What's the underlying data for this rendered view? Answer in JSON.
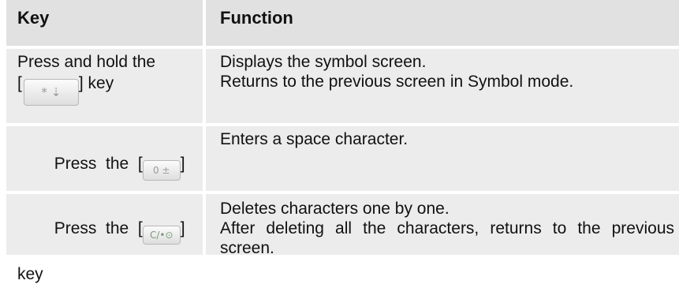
{
  "header": {
    "key": "Key",
    "function": "Function"
  },
  "rows": [
    {
      "key_before": "Press and hold the",
      "key_bracket_open": "[",
      "key_icon": "star-key-icon",
      "key_icon_text": "* ⇣",
      "key_after": "] key",
      "function_lines": [
        "Displays the symbol screen.",
        "Returns to the previous screen in Symbol mode."
      ]
    },
    {
      "key_before": "Press  the  [",
      "key_icon": "zero-key-icon",
      "key_icon_text": "0 ±",
      "key_after": "]",
      "key_last": "key",
      "function_lines": [
        "Enters a space character."
      ]
    },
    {
      "key_before": "Press  the  [",
      "key_icon": "clear-key-icon",
      "key_icon_text": "C/•⊙",
      "key_after": "]",
      "key_last": "key",
      "function_lines": [
        "Deletes characters one by one.",
        "After deleting all the characters, returns to the previous screen."
      ]
    }
  ]
}
